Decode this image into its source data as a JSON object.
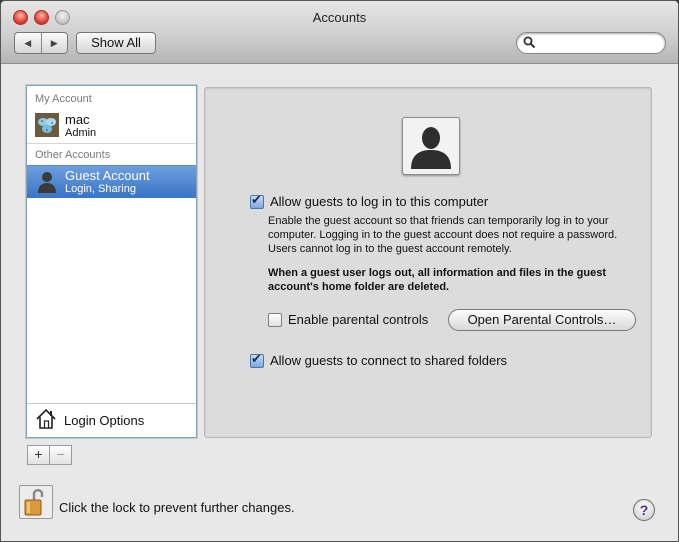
{
  "window": {
    "title": "Accounts"
  },
  "toolbar": {
    "back_icon": "◀",
    "forward_icon": "▶",
    "show_all_label": "Show All",
    "search_value": "",
    "search_placeholder": ""
  },
  "sidebar": {
    "my_account_header": "My Account",
    "my_account": {
      "name": "mac",
      "role": "Admin"
    },
    "other_accounts_header": "Other Accounts",
    "other_accounts": [
      {
        "name": "Guest Account",
        "role": "Login, Sharing",
        "selected": true
      }
    ],
    "login_options_label": "Login Options",
    "add_label": "+",
    "remove_label": "−"
  },
  "guest_settings": {
    "allow_login": {
      "label": "Allow guests to log in to this computer",
      "checked": true
    },
    "description": "Enable the guest account so that friends can temporarily log in to your computer. Logging in to the guest account does not require a password. Users cannot log in to the guest account remotely.",
    "warning": "When a guest user logs out, all information and files in the guest account's home folder are deleted.",
    "parental_controls": {
      "label": "Enable parental controls",
      "checked": false
    },
    "open_parental_controls_label": "Open Parental Controls…",
    "shared_folders": {
      "label": "Allow guests to connect to shared folders",
      "checked": true
    }
  },
  "footer": {
    "lock_text": "Click the lock to prevent further changes.",
    "help_label": "?"
  },
  "colors": {
    "selection": "#3874c8",
    "help_glyph": "#5a2d93"
  }
}
